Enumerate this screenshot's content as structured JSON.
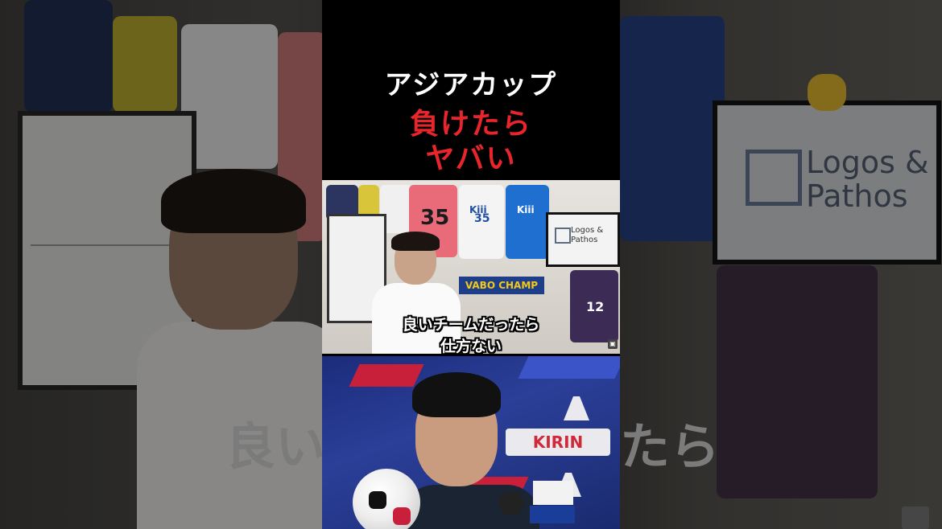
{
  "background": {
    "caption_left": "良い",
    "caption_right": "たら",
    "tv_logo_text": "Logos &\nPathos"
  },
  "title": {
    "line1": "アジアカップ",
    "line2": "負けたら",
    "line3": "ヤバい",
    "line1_color": "#ffffff",
    "accent_color": "#e8252b"
  },
  "video": {
    "caption_line1": "良いチームだったら",
    "caption_line2": "仕方ない",
    "jersey_number_pink": "35",
    "jersey_number_white": "35",
    "jersey_number_purple": "12",
    "sponsor_white": "Kiii",
    "sponsor_blue": "Kiii",
    "banner_text": "VABO CHAMP",
    "tv_logo_text": "Logos &\nPathos"
  },
  "photo": {
    "sponsor_board": "KIRIN",
    "brand_icon": "adidas-logo-icon"
  },
  "icons": [
    "logo-square-icon",
    "channel-corner-icon",
    "soccer-ball-icon",
    "microphone-icon"
  ]
}
